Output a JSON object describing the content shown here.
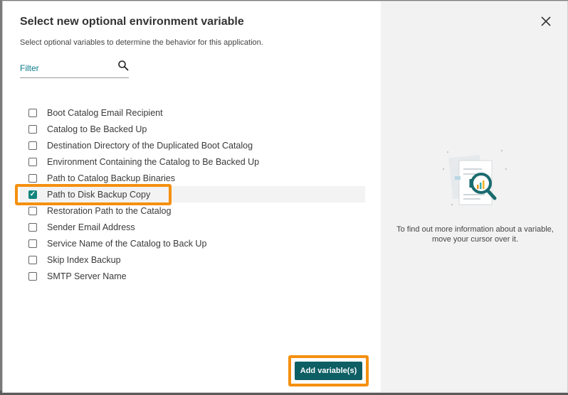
{
  "dialog": {
    "title": "Select new optional environment variable",
    "subtitle": "Select optional variables to determine the behavior for this application.",
    "filter_placeholder": "Filter",
    "variables": [
      {
        "label": "Boot Catalog Email Recipient",
        "checked": false
      },
      {
        "label": "Catalog to Be Backed Up",
        "checked": false
      },
      {
        "label": "Destination Directory of the Duplicated Boot Catalog",
        "checked": false
      },
      {
        "label": "Environment Containing the Catalog to Be Backed Up",
        "checked": false
      },
      {
        "label": "Path to Catalog Backup Binaries",
        "checked": false
      },
      {
        "label": "Path to Disk Backup Copy",
        "checked": true
      },
      {
        "label": "Restoration Path to the Catalog",
        "checked": false
      },
      {
        "label": "Sender Email Address",
        "checked": false
      },
      {
        "label": "Service Name of the Catalog to Back Up",
        "checked": false
      },
      {
        "label": "Skip Index Backup",
        "checked": false
      },
      {
        "label": "SMTP Server Name",
        "checked": false
      }
    ],
    "add_button_label": "Add variable(s)",
    "info_text": "To find out more information about a variable, move your cursor over it."
  },
  "icons": {
    "search": "search-icon",
    "close": "close-icon",
    "check": "check-icon"
  },
  "colors": {
    "accent": "#0d5f64",
    "checkbox_checked": "#11857c",
    "highlight": "#f5900f",
    "link": "#0a7a8a"
  }
}
